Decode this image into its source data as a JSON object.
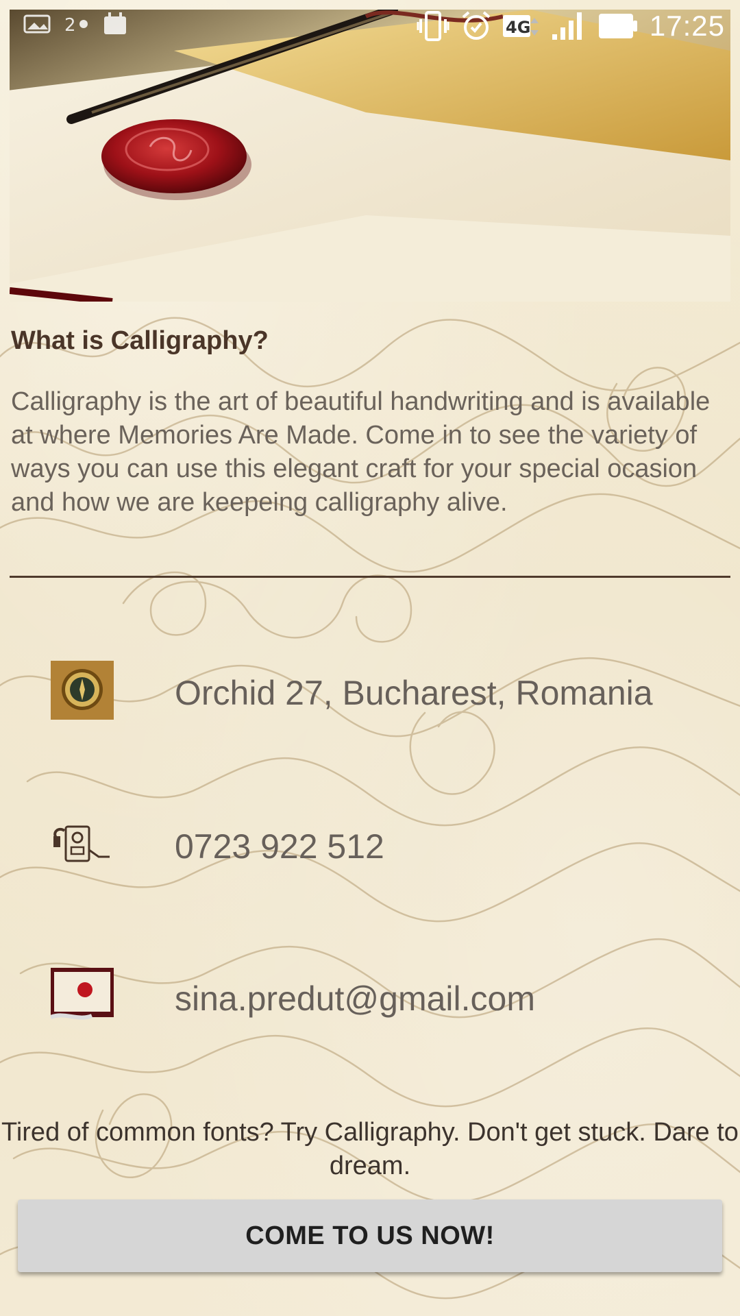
{
  "status_bar": {
    "time": "17:25",
    "network_type": "4G",
    "left_icons": [
      "photo-icon",
      "notification-icon",
      "calendar-icon"
    ],
    "right_icons": [
      "vibrate-icon",
      "alarm-icon",
      "4g-icon",
      "signal-icon",
      "battery-icon"
    ]
  },
  "hero": {
    "image": "quill-pen-wax-seal-letter"
  },
  "content": {
    "title": "What is Calligraphy?",
    "intro": "Calligraphy is the art of beautiful handwriting and is available at where Memories Are Made. Come in to see the variety of ways you can use this elegant craft for your special ocasion and how we are keepeing calligraphy alive."
  },
  "contacts": {
    "address": "Orchid 27, Bucharest, Romania",
    "phone": "0723 922 512",
    "email": "sina.predut@gmail.com"
  },
  "footer": {
    "tagline": "Tired of common fonts? Try Calligraphy. Don't get stuck. Dare to dream.",
    "cta_label": "COME TO US NOW!"
  },
  "colors": {
    "paper": "#f1e8cf",
    "title": "#4a3528",
    "body_text": "#6a625a",
    "divider": "#4f3a2c",
    "button": "#d6d6d6",
    "wax_seal": "#9e1118"
  }
}
